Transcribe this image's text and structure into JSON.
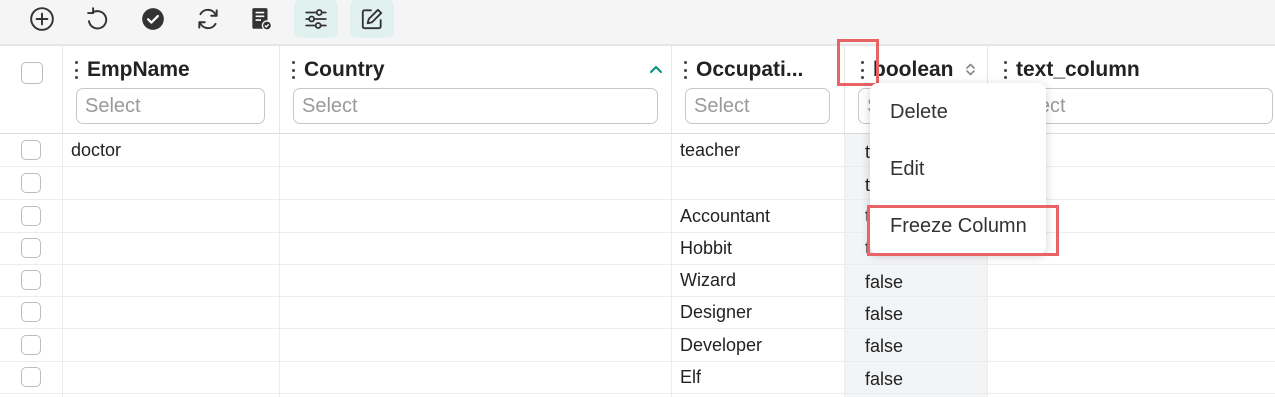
{
  "toolbar": {
    "buttons": [
      {
        "name": "add",
        "icon": "plus-circle-icon"
      },
      {
        "name": "undo",
        "icon": "undo-icon"
      },
      {
        "name": "save",
        "icon": "check-circle-icon"
      },
      {
        "name": "refresh",
        "icon": "refresh-icon"
      },
      {
        "name": "validate",
        "icon": "document-check-icon"
      },
      {
        "name": "filter-settings",
        "icon": "sliders-icon"
      },
      {
        "name": "edit",
        "icon": "edit-icon"
      }
    ]
  },
  "columns": [
    {
      "key": "empname",
      "label": "EmpName",
      "placeholder": "Select"
    },
    {
      "key": "country",
      "label": "Country",
      "placeholder": "Select",
      "sort": "ascending"
    },
    {
      "key": "occupation",
      "label": "Occupati...",
      "placeholder": "Select"
    },
    {
      "key": "boolean",
      "label": "boolean",
      "placeholder": "Select",
      "sort": "none"
    },
    {
      "key": "text_column",
      "label": "text_column",
      "placeholder": "Select"
    }
  ],
  "rows": [
    {
      "empname": "doctor",
      "country": "",
      "occupation": "teacher",
      "boolean": "t"
    },
    {
      "empname": "",
      "country": "",
      "occupation": "",
      "boolean": "t"
    },
    {
      "empname": "",
      "country": "",
      "occupation": "Accountant",
      "boolean": "t"
    },
    {
      "empname": "",
      "country": "",
      "occupation": "Hobbit",
      "boolean": "t"
    },
    {
      "empname": "",
      "country": "",
      "occupation": "Wizard",
      "boolean": "false"
    },
    {
      "empname": "",
      "country": "",
      "occupation": "Designer",
      "boolean": "false"
    },
    {
      "empname": "",
      "country": "",
      "occupation": "Developer",
      "boolean": "false"
    },
    {
      "empname": "",
      "country": "",
      "occupation": "Elf",
      "boolean": "false"
    }
  ],
  "context_menu": {
    "items": [
      "Delete",
      "Edit",
      "Freeze Column"
    ]
  },
  "colors": {
    "accent": "#0f9488",
    "highlight": "#e86266",
    "active_button_bg": "#e0f1ef"
  }
}
